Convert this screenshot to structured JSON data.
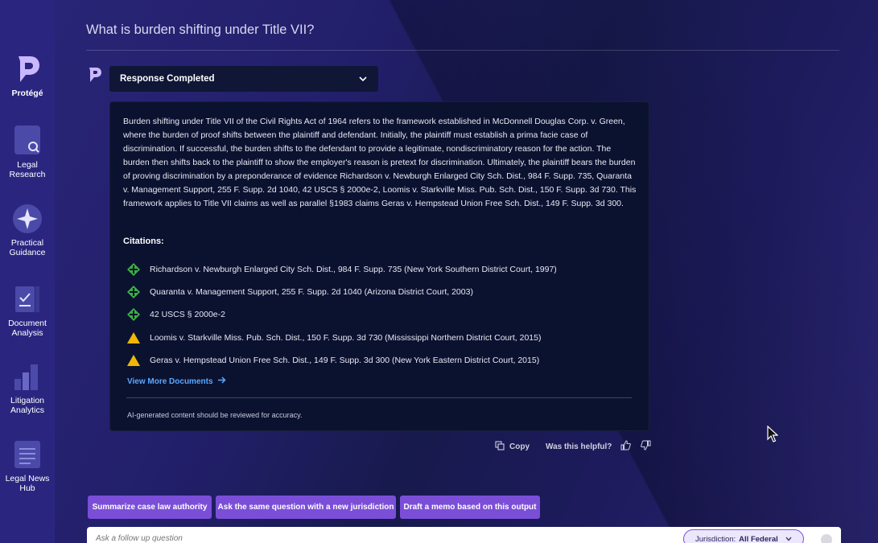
{
  "header": {
    "question": "What is burden shifting under Title VII?"
  },
  "sidebar": {
    "items": [
      {
        "label": "Protégé",
        "icon": "protege-logo-icon"
      },
      {
        "label": "Legal\nResearch",
        "icon": "search-document-icon"
      },
      {
        "label": "Practical\nGuidance",
        "icon": "compass-star-icon"
      },
      {
        "label": "Document\nAnalysis",
        "icon": "document-check-icon"
      },
      {
        "label": "Litigation\nAnalytics",
        "icon": "bar-chart-icon"
      },
      {
        "label": "Legal News\nHub",
        "icon": "newspaper-icon"
      }
    ]
  },
  "response": {
    "status": "Response Completed",
    "answer": "Burden shifting under Title VII of the Civil Rights Act of 1964 refers to the framework established in McDonnell Douglas Corp. v. Green, where the burden of proof shifts between the plaintiff and defendant. Initially, the plaintiff must establish a prima facie case of discrimination. If successful, the burden shifts to the defendant to provide a legitimate, nondiscriminatory reason for the action. The burden then shifts back to the plaintiff to show the employer's reason is pretext for discrimination. Ultimately, the plaintiff bears the burden of proving discrimination by a preponderance of evidence Richardson v. Newburgh Enlarged City Sch. Dist., 984 F. Supp. 735, Quaranta v. Management Support, 255 F. Supp. 2d 1040, 42 USCS § 2000e-2, Loomis v. Starkville Miss. Pub. Sch. Dist., 150 F. Supp. 3d 730. This framework applies to Title VII claims as well as parallel §1983 claims Geras v. Hempstead Union Free Sch. Dist., 149 F. Supp. 3d 300.",
    "citations_title": "Citations:",
    "citations": [
      {
        "text": "Richardson v. Newburgh Enlarged City Sch. Dist., 984 F. Supp. 735 (New York Southern District Court, 1997)",
        "signal": "positive"
      },
      {
        "text": "Quaranta v. Management Support, 255 F. Supp. 2d 1040 (Arizona District Court, 2003)",
        "signal": "positive"
      },
      {
        "text": "42 USCS § 2000e-2",
        "signal": "positive"
      },
      {
        "text": "Loomis v. Starkville Miss. Pub. Sch. Dist., 150 F. Supp. 3d 730 (Mississippi Northern District Court, 2015)",
        "signal": "caution"
      },
      {
        "text": "Geras v. Hempstead Union Free Sch. Dist., 149 F. Supp. 3d 300 (New York Eastern District Court, 2015)",
        "signal": "caution"
      }
    ],
    "view_more": "View More Documents",
    "disclaimer": "AI-generated content should be reviewed for accuracy."
  },
  "feedback": {
    "copy": "Copy",
    "helpful": "Was this helpful?"
  },
  "suggestions": [
    "Summarize case law authority",
    "Ask the same question with a new jurisdiction",
    "Draft a memo based on this output"
  ],
  "followup": {
    "placeholder": "Ask a follow up question",
    "jurisdiction_label": "Jurisdiction:",
    "jurisdiction_value": "All Federal"
  },
  "colors": {
    "accent": "#7b4ed8",
    "positive": "#3cb043",
    "caution": "#f2b705",
    "link": "#5aa8ff"
  }
}
